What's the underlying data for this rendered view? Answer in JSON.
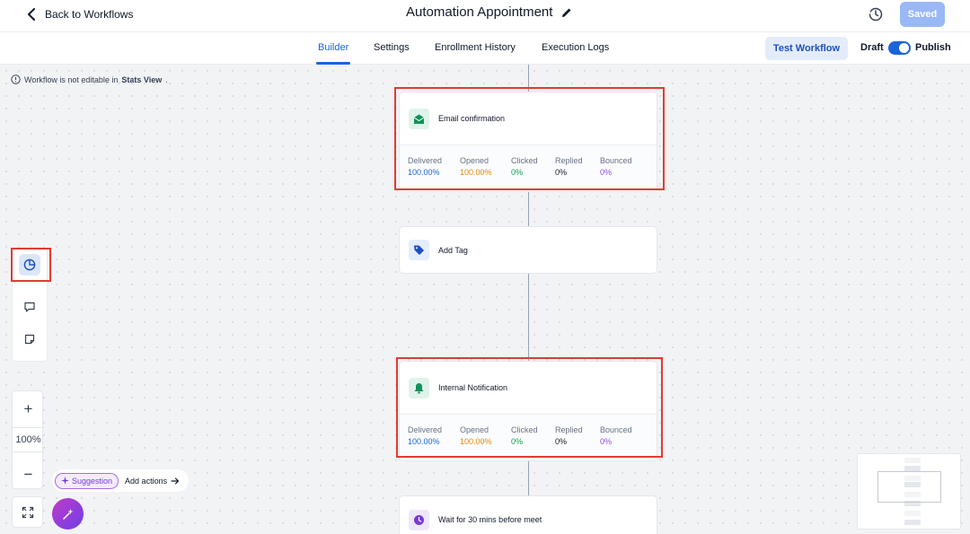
{
  "header": {
    "back_label": "Back to Workflows",
    "title": "Automation Appointment",
    "saved_label": "Saved"
  },
  "tabs": [
    {
      "label": "Builder",
      "active": true
    },
    {
      "label": "Settings",
      "active": false
    },
    {
      "label": "Enrollment History",
      "active": false
    },
    {
      "label": "Execution Logs",
      "active": false
    }
  ],
  "actions": {
    "test_label": "Test Workflow",
    "draft_label": "Draft",
    "publish_label": "Publish",
    "publish_toggle_on": true
  },
  "canvas": {
    "notice_text": "Workflow is not editable in",
    "notice_bold": "Stats View",
    "notice_end": ".",
    "zoom_level": "100%",
    "suggestion_label": "Suggestion",
    "add_actions_label": "Add actions"
  },
  "nodes": [
    {
      "title": "Email confirmation",
      "icon": "email-open-icon",
      "stats": [
        {
          "label": "Delivered",
          "value": "100.00%",
          "color": "#1b64da"
        },
        {
          "label": "Opened",
          "value": "100.00%",
          "color": "#e3870b"
        },
        {
          "label": "Clicked",
          "value": "0%",
          "color": "#12a150"
        },
        {
          "label": "Replied",
          "value": "0%",
          "color": "#101828"
        },
        {
          "label": "Bounced",
          "value": "0%",
          "color": "#8d4ee6"
        }
      ]
    },
    {
      "title": "Add Tag",
      "icon": "tag-icon"
    },
    {
      "title": "Internal Notification",
      "icon": "bell-icon",
      "stats": [
        {
          "label": "Delivered",
          "value": "100.00%",
          "color": "#1b64da"
        },
        {
          "label": "Opened",
          "value": "100.00%",
          "color": "#e3870b"
        },
        {
          "label": "Clicked",
          "value": "0%",
          "color": "#12a150"
        },
        {
          "label": "Replied",
          "value": "0%",
          "color": "#101828"
        },
        {
          "label": "Bounced",
          "value": "0%",
          "color": "#8d4ee6"
        }
      ]
    },
    {
      "title": "Wait for 30 mins before meet",
      "icon": "clock-icon"
    }
  ],
  "colors": {
    "accent": "#1b64da",
    "highlight": "#e23b31",
    "email_icon_bg": "#dff3ea",
    "tag_icon_bg": "#e6edfb",
    "bell_icon_bg": "#dff3ea",
    "wait_icon_bg": "#efe7fb"
  }
}
